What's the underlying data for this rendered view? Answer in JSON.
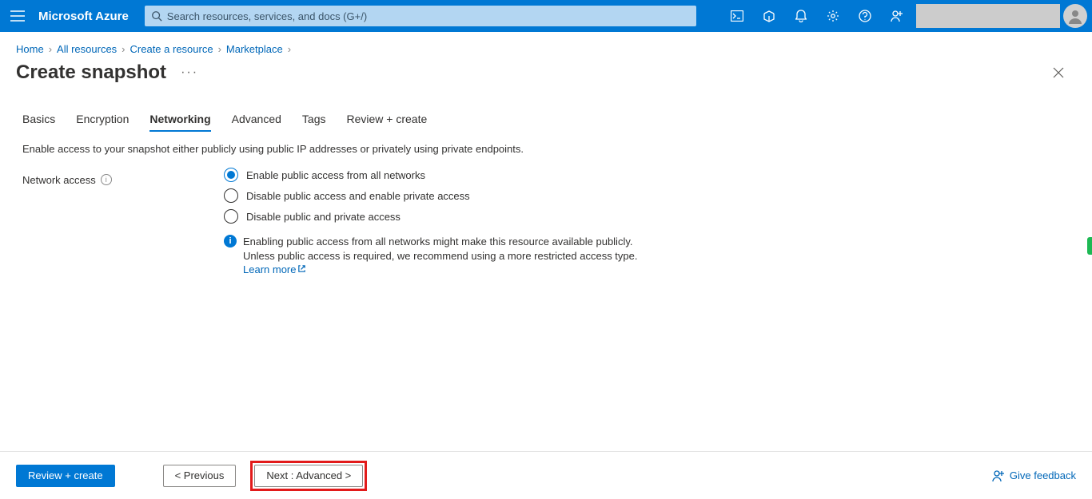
{
  "header": {
    "brand": "Microsoft Azure",
    "search_placeholder": "Search resources, services, and docs (G+/)"
  },
  "breadcrumb": {
    "items": [
      "Home",
      "All resources",
      "Create a resource",
      "Marketplace"
    ]
  },
  "page": {
    "title": "Create snapshot"
  },
  "tabs": [
    "Basics",
    "Encryption",
    "Networking",
    "Advanced",
    "Tags",
    "Review + create"
  ],
  "active_tab_index": 2,
  "description": "Enable access to your snapshot either publicly using public IP addresses or privately using private endpoints.",
  "form": {
    "network_access_label": "Network access",
    "options": [
      "Enable public access from all networks",
      "Disable public access and enable private access",
      "Disable public and private access"
    ],
    "selected_index": 0,
    "note_text": "Enabling public access from all networks might make this resource available publicly. Unless public access is required, we recommend using a more restricted access type.",
    "learn_more": "Learn more"
  },
  "footer": {
    "review_create": "Review + create",
    "previous": "< Previous",
    "next": "Next : Advanced >",
    "feedback": "Give feedback"
  }
}
